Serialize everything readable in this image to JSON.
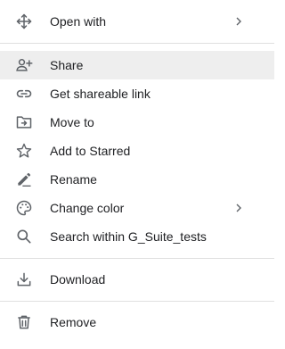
{
  "menu": {
    "items": [
      {
        "label": "Open with",
        "icon": "open-with-icon",
        "submenu": true
      },
      {
        "label": "Share",
        "icon": "person-add-icon",
        "highlighted": true
      },
      {
        "label": "Get shareable link",
        "icon": "link-icon"
      },
      {
        "label": "Move to",
        "icon": "move-to-folder-icon"
      },
      {
        "label": "Add to Starred",
        "icon": "star-icon"
      },
      {
        "label": "Rename",
        "icon": "pencil-icon"
      },
      {
        "label": "Change color",
        "icon": "palette-icon",
        "submenu": true
      },
      {
        "label": "Search within G_Suite_tests",
        "icon": "search-icon"
      },
      {
        "label": "Download",
        "icon": "download-icon"
      },
      {
        "label": "Remove",
        "icon": "trash-icon"
      }
    ]
  },
  "colors": {
    "icon": "#5f6368",
    "text": "#202124",
    "highlight": "#eeeeee",
    "divider": "#e0e0e0"
  }
}
